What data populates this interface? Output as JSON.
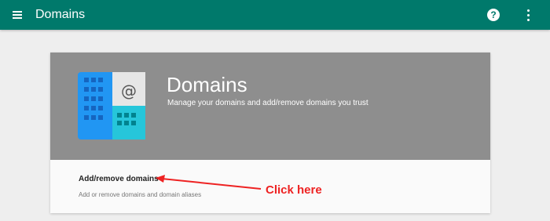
{
  "topbar": {
    "menu_icon": "hamburger-menu-icon",
    "title": "Domains",
    "help_icon": "help-circle-icon",
    "help_glyph": "?",
    "more_icon": "more-vertical-icon",
    "color": "#00796b"
  },
  "card": {
    "title": "Domains",
    "subtitle": "Manage your domains and add/remove domains you trust",
    "header_color": "#8e8e8e",
    "icon": "domains-building-at-icon",
    "icon_glyph": "@",
    "action": {
      "label": "Add/remove domains",
      "description": "Add or remove domains and domain aliases"
    }
  },
  "annotation": {
    "text": "Click here",
    "color": "#ee2222"
  }
}
